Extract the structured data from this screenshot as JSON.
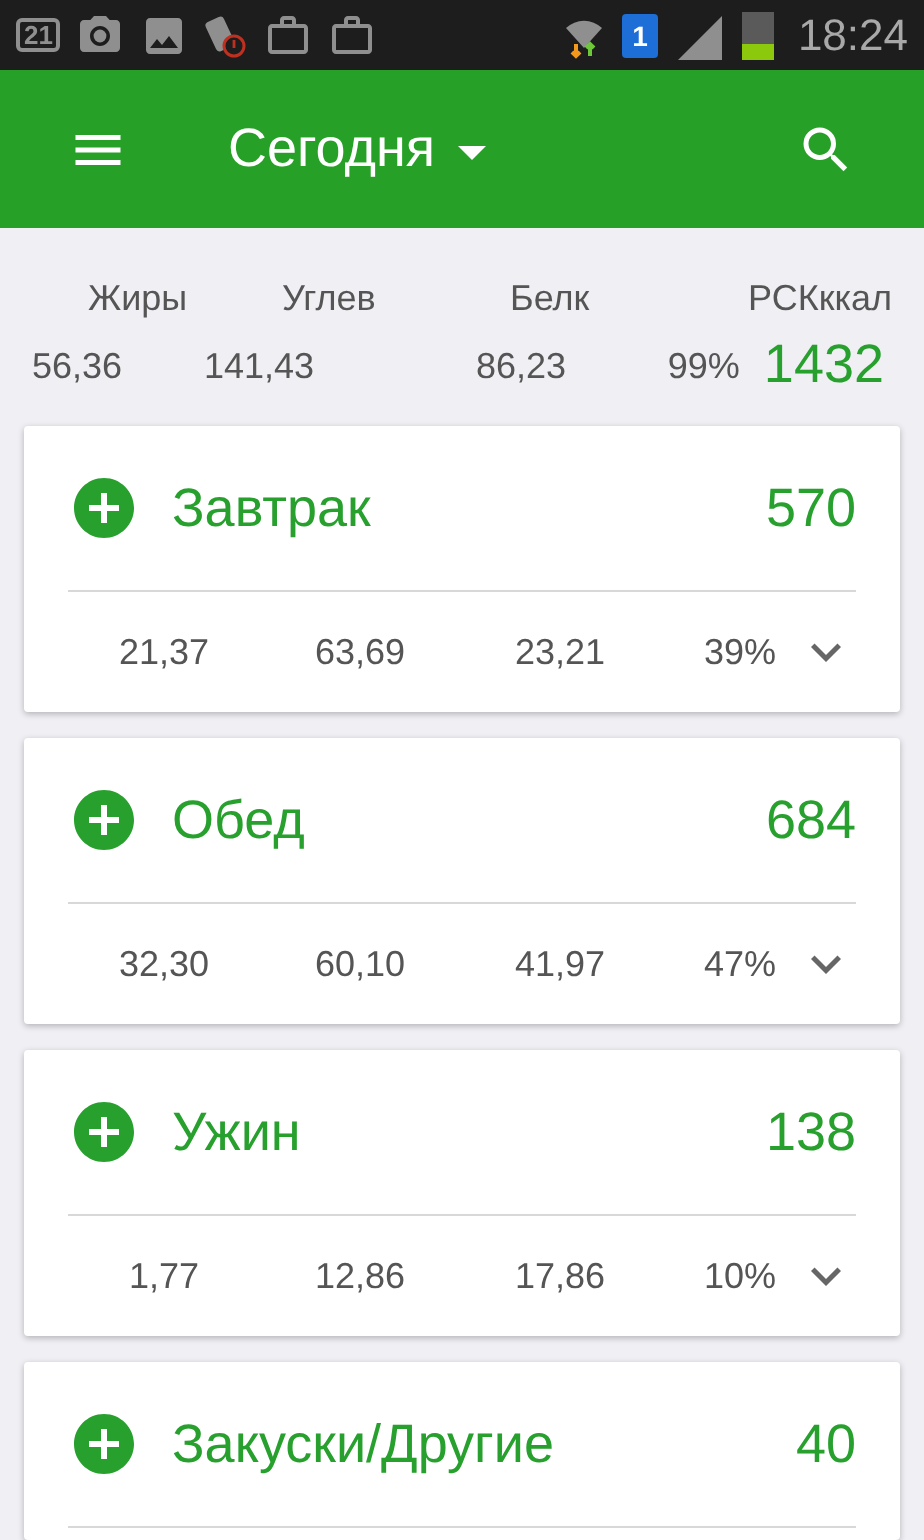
{
  "status_bar": {
    "calendar_day": "21",
    "sim_number": "1",
    "time": "18:24"
  },
  "app_bar": {
    "title": "Сегодня"
  },
  "summary": {
    "labels": [
      "Жиры",
      "Углев",
      "Белк",
      "РСКккал"
    ],
    "values": [
      "56,36",
      "141,43",
      "86,23",
      "99%"
    ],
    "calories": "1432"
  },
  "meals": [
    {
      "name": "Завтрак",
      "calories": "570",
      "stats": [
        "21,37",
        "63,69",
        "23,21",
        "39%"
      ]
    },
    {
      "name": "Обед",
      "calories": "684",
      "stats": [
        "32,30",
        "60,10",
        "41,97",
        "47%"
      ]
    },
    {
      "name": "Ужин",
      "calories": "138",
      "stats": [
        "1,77",
        "12,86",
        "17,86",
        "10%"
      ]
    },
    {
      "name": "Закуски/Другие",
      "calories": "40"
    }
  ]
}
